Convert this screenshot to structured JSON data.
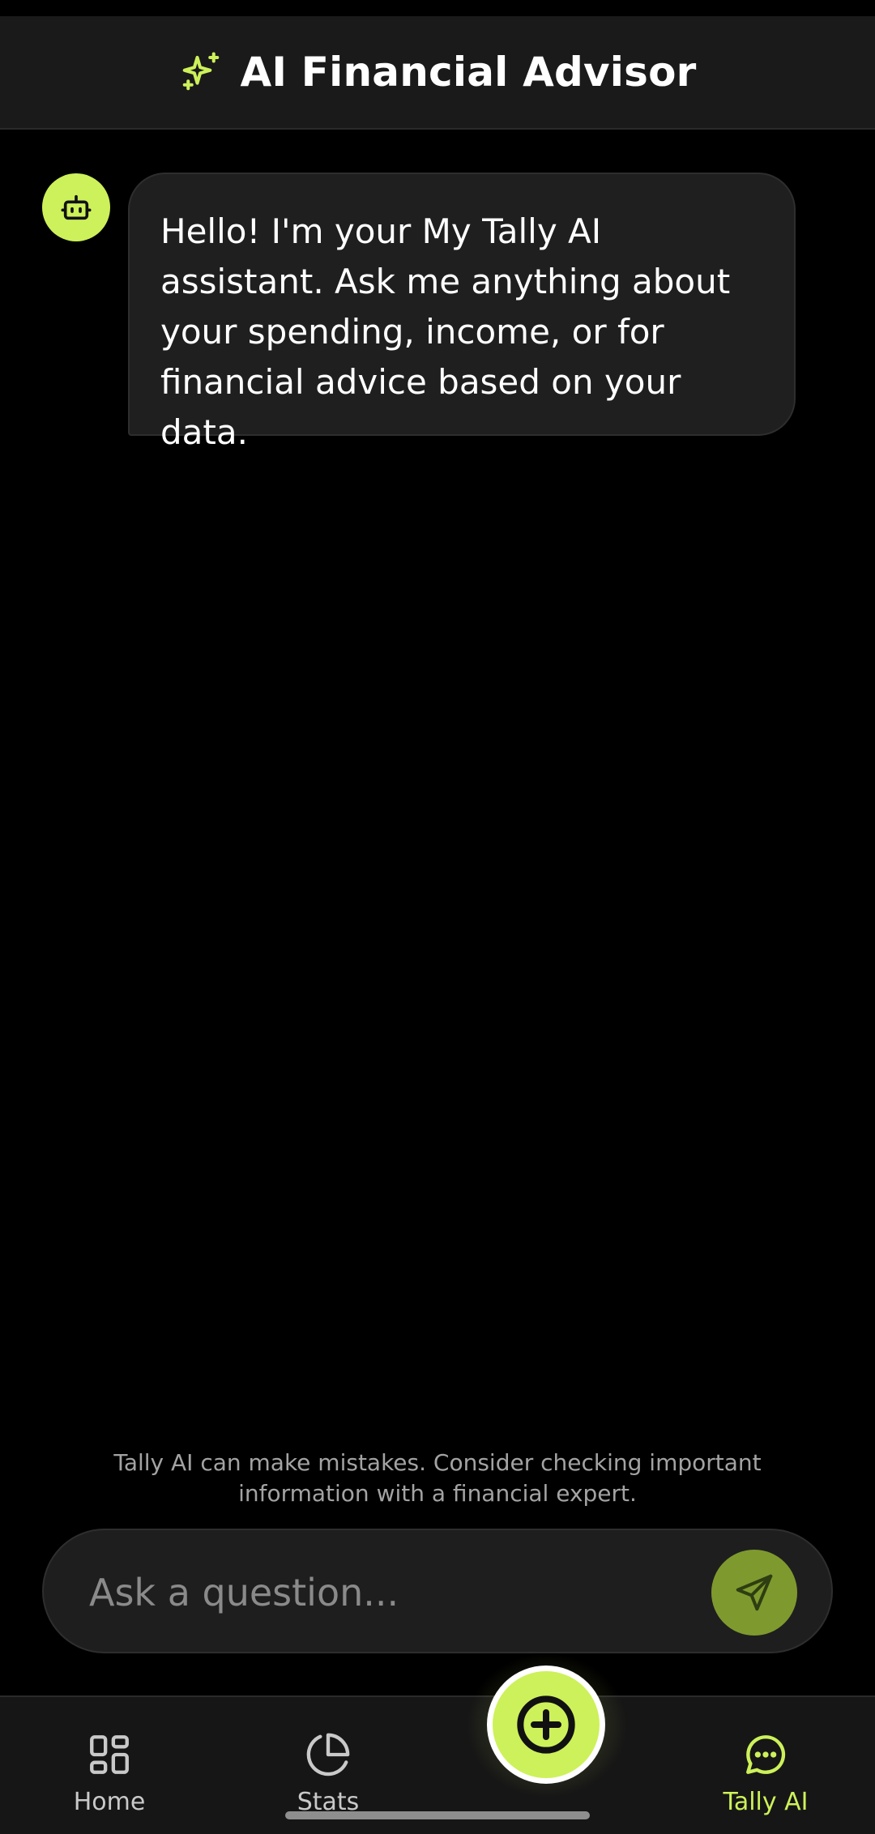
{
  "header": {
    "title": "AI Financial Advisor",
    "icon": "sparkles-icon"
  },
  "chat": {
    "messages": [
      {
        "role": "assistant",
        "avatar_icon": "bot-icon",
        "text": "Hello! I'm your My Tally AI assistant. Ask me anything about your spending, income, or for financial advice based on your data."
      }
    ]
  },
  "disclaimer": "Tally AI can make mistakes. Consider checking important information with a financial expert.",
  "composer": {
    "placeholder": "Ask a question...",
    "send_icon": "send-icon"
  },
  "nav": {
    "items": [
      {
        "label": "Home",
        "icon": "grid-icon",
        "active": false
      },
      {
        "label": "Stats",
        "icon": "pie-chart-icon",
        "active": false
      },
      {
        "label": "Tally AI",
        "icon": "chat-bubble-icon",
        "active": true
      }
    ],
    "fab_icon": "plus-circle-icon"
  },
  "colors": {
    "accent": "#cdf15a",
    "background": "#000000",
    "surface": "#1f1f20",
    "send_button": "#7e9a2e"
  }
}
